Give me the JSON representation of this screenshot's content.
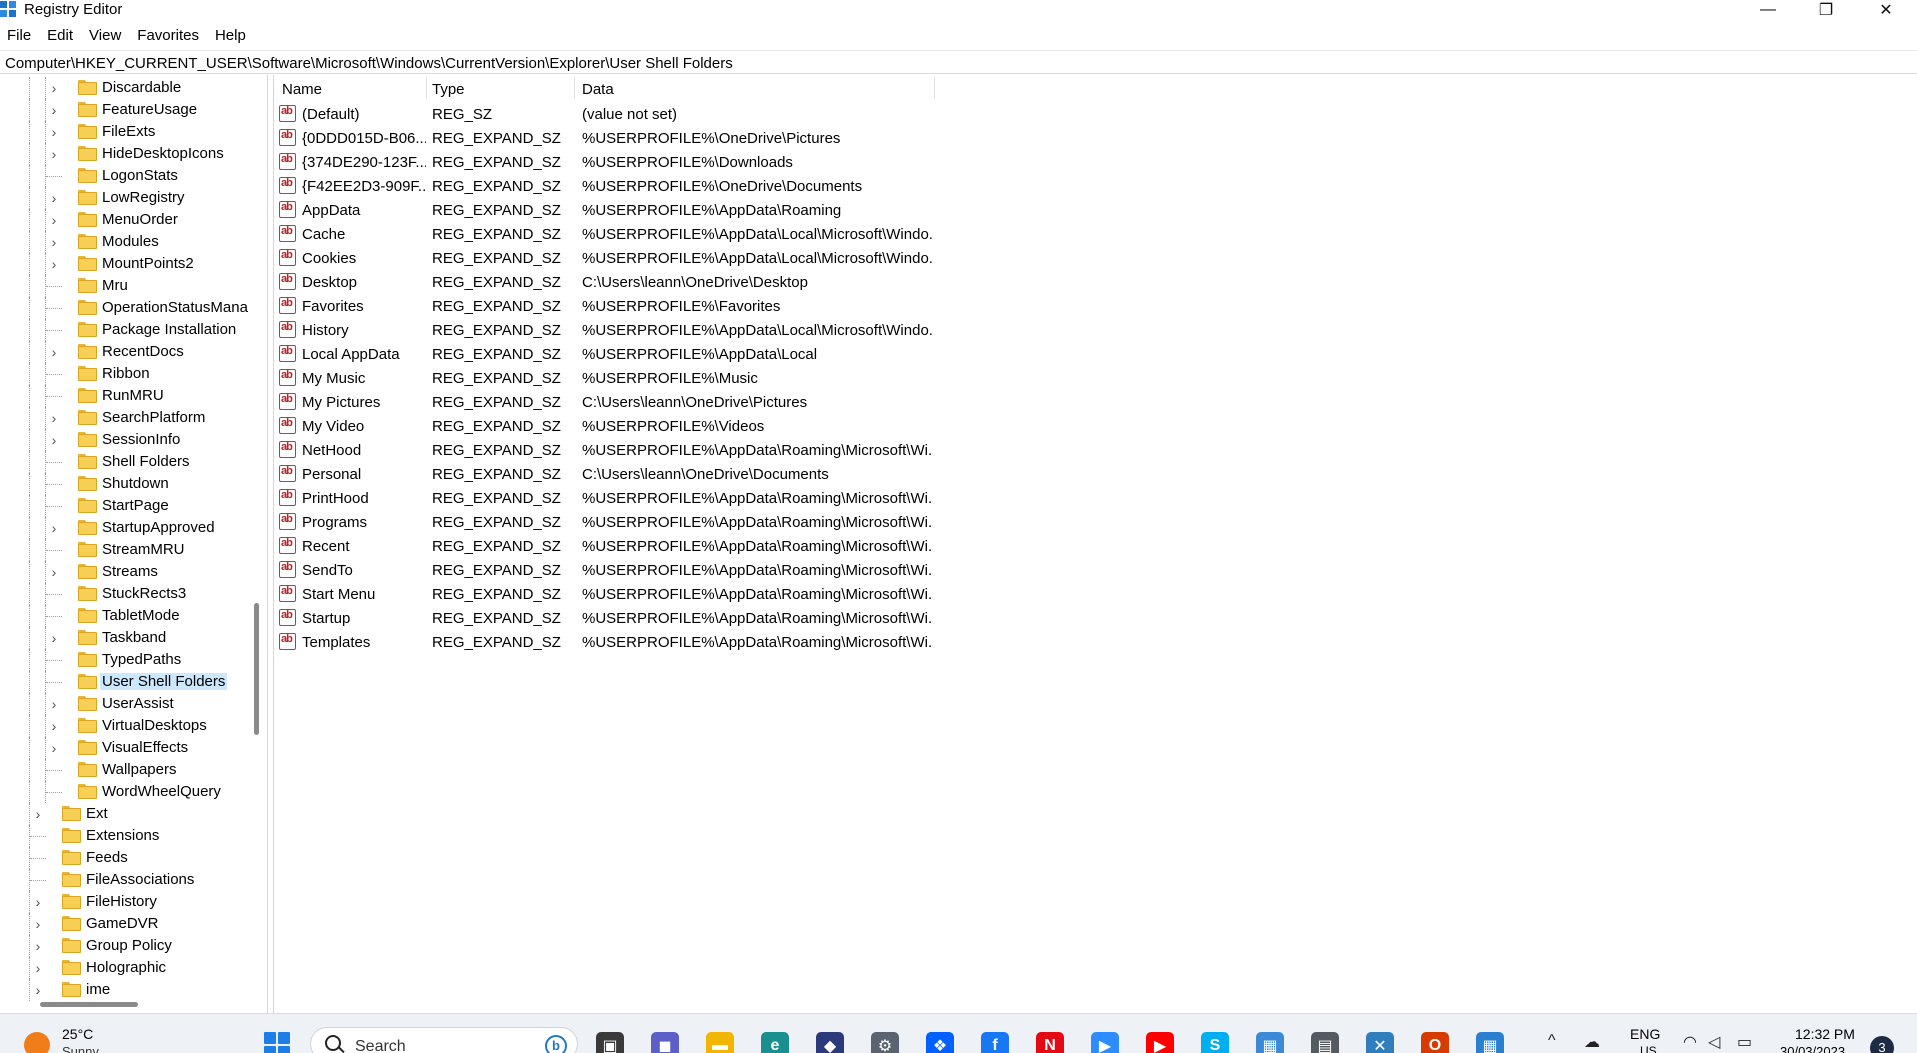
{
  "window": {
    "title": "Registry Editor",
    "controls": {
      "minimize": "—",
      "maximize": "❐",
      "close": "✕"
    }
  },
  "menu": [
    "File",
    "Edit",
    "View",
    "Favorites",
    "Help"
  ],
  "address": "Computer\\HKEY_CURRENT_USER\\Software\\Microsoft\\Windows\\CurrentVersion\\Explorer\\User Shell Folders",
  "tree": [
    {
      "label": "Discardable",
      "level": 2,
      "expandable": true
    },
    {
      "label": "FeatureUsage",
      "level": 2,
      "expandable": true
    },
    {
      "label": "FileExts",
      "level": 2,
      "expandable": true
    },
    {
      "label": "HideDesktopIcons",
      "level": 2,
      "expandable": true
    },
    {
      "label": "LogonStats",
      "level": 2,
      "expandable": false
    },
    {
      "label": "LowRegistry",
      "level": 2,
      "expandable": true
    },
    {
      "label": "MenuOrder",
      "level": 2,
      "expandable": true
    },
    {
      "label": "Modules",
      "level": 2,
      "expandable": true
    },
    {
      "label": "MountPoints2",
      "level": 2,
      "expandable": true
    },
    {
      "label": "Mru",
      "level": 2,
      "expandable": false
    },
    {
      "label": "OperationStatusMana",
      "level": 2,
      "expandable": false
    },
    {
      "label": "Package Installation",
      "level": 2,
      "expandable": false
    },
    {
      "label": "RecentDocs",
      "level": 2,
      "expandable": true
    },
    {
      "label": "Ribbon",
      "level": 2,
      "expandable": false
    },
    {
      "label": "RunMRU",
      "level": 2,
      "expandable": false
    },
    {
      "label": "SearchPlatform",
      "level": 2,
      "expandable": true
    },
    {
      "label": "SessionInfo",
      "level": 2,
      "expandable": true
    },
    {
      "label": "Shell Folders",
      "level": 2,
      "expandable": false
    },
    {
      "label": "Shutdown",
      "level": 2,
      "expandable": false
    },
    {
      "label": "StartPage",
      "level": 2,
      "expandable": false
    },
    {
      "label": "StartupApproved",
      "level": 2,
      "expandable": true
    },
    {
      "label": "StreamMRU",
      "level": 2,
      "expandable": false
    },
    {
      "label": "Streams",
      "level": 2,
      "expandable": true
    },
    {
      "label": "StuckRects3",
      "level": 2,
      "expandable": false
    },
    {
      "label": "TabletMode",
      "level": 2,
      "expandable": false
    },
    {
      "label": "Taskband",
      "level": 2,
      "expandable": true
    },
    {
      "label": "TypedPaths",
      "level": 2,
      "expandable": false
    },
    {
      "label": "User Shell Folders",
      "level": 2,
      "expandable": false,
      "selected": true
    },
    {
      "label": "UserAssist",
      "level": 2,
      "expandable": true
    },
    {
      "label": "VirtualDesktops",
      "level": 2,
      "expandable": true
    },
    {
      "label": "VisualEffects",
      "level": 2,
      "expandable": true
    },
    {
      "label": "Wallpapers",
      "level": 2,
      "expandable": false
    },
    {
      "label": "WordWheelQuery",
      "level": 2,
      "expandable": false
    },
    {
      "label": "Ext",
      "level": 1,
      "expandable": true
    },
    {
      "label": "Extensions",
      "level": 1,
      "expandable": false
    },
    {
      "label": "Feeds",
      "level": 1,
      "expandable": false
    },
    {
      "label": "FileAssociations",
      "level": 1,
      "expandable": false
    },
    {
      "label": "FileHistory",
      "level": 1,
      "expandable": true
    },
    {
      "label": "GameDVR",
      "level": 1,
      "expandable": true
    },
    {
      "label": "Group Policy",
      "level": 1,
      "expandable": true
    },
    {
      "label": "Holographic",
      "level": 1,
      "expandable": true
    },
    {
      "label": "ime",
      "level": 1,
      "expandable": true
    }
  ],
  "columns": {
    "name": "Name",
    "type": "Type",
    "data": "Data"
  },
  "values": [
    {
      "name": "(Default)",
      "type": "REG_SZ",
      "data": "(value not set)"
    },
    {
      "name": "{0DDD015D-B06...",
      "type": "REG_EXPAND_SZ",
      "data": "%USERPROFILE%\\OneDrive\\Pictures"
    },
    {
      "name": "{374DE290-123F...",
      "type": "REG_EXPAND_SZ",
      "data": "%USERPROFILE%\\Downloads"
    },
    {
      "name": "{F42EE2D3-909F...",
      "type": "REG_EXPAND_SZ",
      "data": "%USERPROFILE%\\OneDrive\\Documents"
    },
    {
      "name": "AppData",
      "type": "REG_EXPAND_SZ",
      "data": "%USERPROFILE%\\AppData\\Roaming"
    },
    {
      "name": "Cache",
      "type": "REG_EXPAND_SZ",
      "data": "%USERPROFILE%\\AppData\\Local\\Microsoft\\Windo..."
    },
    {
      "name": "Cookies",
      "type": "REG_EXPAND_SZ",
      "data": "%USERPROFILE%\\AppData\\Local\\Microsoft\\Windo..."
    },
    {
      "name": "Desktop",
      "type": "REG_EXPAND_SZ",
      "data": "C:\\Users\\leann\\OneDrive\\Desktop"
    },
    {
      "name": "Favorites",
      "type": "REG_EXPAND_SZ",
      "data": "%USERPROFILE%\\Favorites"
    },
    {
      "name": "History",
      "type": "REG_EXPAND_SZ",
      "data": "%USERPROFILE%\\AppData\\Local\\Microsoft\\Windo..."
    },
    {
      "name": "Local AppData",
      "type": "REG_EXPAND_SZ",
      "data": "%USERPROFILE%\\AppData\\Local"
    },
    {
      "name": "My Music",
      "type": "REG_EXPAND_SZ",
      "data": "%USERPROFILE%\\Music"
    },
    {
      "name": "My Pictures",
      "type": "REG_EXPAND_SZ",
      "data": "C:\\Users\\leann\\OneDrive\\Pictures"
    },
    {
      "name": "My Video",
      "type": "REG_EXPAND_SZ",
      "data": "%USERPROFILE%\\Videos"
    },
    {
      "name": "NetHood",
      "type": "REG_EXPAND_SZ",
      "data": "%USERPROFILE%\\AppData\\Roaming\\Microsoft\\Wi..."
    },
    {
      "name": "Personal",
      "type": "REG_EXPAND_SZ",
      "data": "C:\\Users\\leann\\OneDrive\\Documents"
    },
    {
      "name": "PrintHood",
      "type": "REG_EXPAND_SZ",
      "data": "%USERPROFILE%\\AppData\\Roaming\\Microsoft\\Wi..."
    },
    {
      "name": "Programs",
      "type": "REG_EXPAND_SZ",
      "data": "%USERPROFILE%\\AppData\\Roaming\\Microsoft\\Wi..."
    },
    {
      "name": "Recent",
      "type": "REG_EXPAND_SZ",
      "data": "%USERPROFILE%\\AppData\\Roaming\\Microsoft\\Wi..."
    },
    {
      "name": "SendTo",
      "type": "REG_EXPAND_SZ",
      "data": "%USERPROFILE%\\AppData\\Roaming\\Microsoft\\Wi..."
    },
    {
      "name": "Start Menu",
      "type": "REG_EXPAND_SZ",
      "data": "%USERPROFILE%\\AppData\\Roaming\\Microsoft\\Wi..."
    },
    {
      "name": "Startup",
      "type": "REG_EXPAND_SZ",
      "data": "%USERPROFILE%\\AppData\\Roaming\\Microsoft\\Wi..."
    },
    {
      "name": "Templates",
      "type": "REG_EXPAND_SZ",
      "data": "%USERPROFILE%\\AppData\\Roaming\\Microsoft\\Wi..."
    }
  ],
  "value_icon_text": "ab",
  "taskbar": {
    "weather_temp": "25°C",
    "weather_condition": "Sunny",
    "search_placeholder": "Search",
    "bing_label": "b",
    "apps": [
      {
        "name": "task-view",
        "glyph": "▣",
        "color": "#3a3a3a"
      },
      {
        "name": "chat",
        "glyph": "◼",
        "color": "#5b5fc7"
      },
      {
        "name": "file-explorer",
        "glyph": "▬",
        "color": "#f2b600"
      },
      {
        "name": "edge",
        "glyph": "e",
        "color": "#1a8f8f"
      },
      {
        "name": "app-blue",
        "glyph": "◆",
        "color": "#2a3a7a"
      },
      {
        "name": "settings",
        "glyph": "⚙",
        "color": "#5a6470"
      },
      {
        "name": "dropbox",
        "glyph": "❖",
        "color": "#0061fe"
      },
      {
        "name": "facebook",
        "glyph": "f",
        "color": "#1877f2"
      },
      {
        "name": "netflix",
        "glyph": "N",
        "color": "#e50914"
      },
      {
        "name": "zoom",
        "glyph": "▶",
        "color": "#2d8cff"
      },
      {
        "name": "youtube",
        "glyph": "▶",
        "color": "#ff0000"
      },
      {
        "name": "skype",
        "glyph": "S",
        "color": "#00aff0"
      },
      {
        "name": "photos",
        "glyph": "▦",
        "color": "#3a8ad8"
      },
      {
        "name": "calculator",
        "glyph": "▤",
        "color": "#555a60"
      },
      {
        "name": "tools",
        "glyph": "✕",
        "color": "#2f7fbf"
      },
      {
        "name": "office",
        "glyph": "O",
        "color": "#d83b01"
      },
      {
        "name": "regedit",
        "glyph": "▦",
        "color": "#2b7fd0"
      }
    ],
    "tray": {
      "chevron": "^",
      "lang": "ENG",
      "lang_sub": "US",
      "time": "12:32 PM",
      "date": "30/03/2023",
      "notifications": "3"
    }
  }
}
